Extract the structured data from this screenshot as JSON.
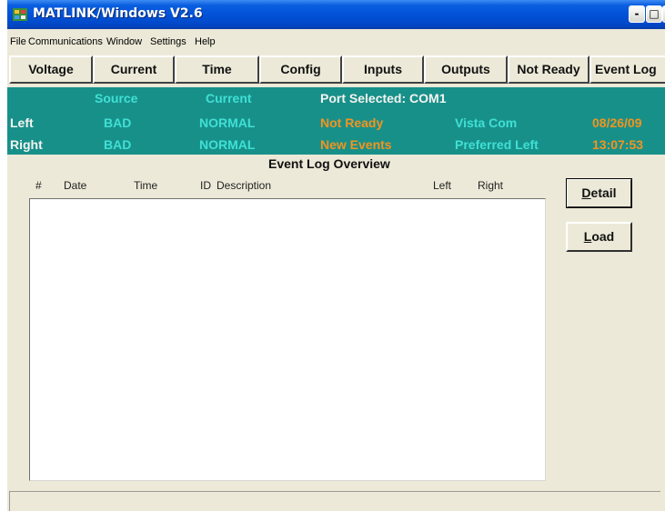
{
  "window": {
    "title": "MATLINK/Windows V2.6",
    "min_glyph": "-",
    "max_glyph": "□",
    "close_glyph": "x"
  },
  "menu": [
    "File",
    "Communications",
    "Window",
    "Settings",
    "Help"
  ],
  "toolbar": [
    "Voltage",
    "Current",
    "Time",
    "Config",
    "Inputs",
    "Outputs",
    "Not Ready",
    "Event Log"
  ],
  "status": {
    "header_source": "Source",
    "header_current": "Current",
    "port_selected": "Port Selected: COM1",
    "left_label": "Left",
    "left_source": "BAD",
    "left_current": "NORMAL",
    "left_state": "Not Ready",
    "left_info": "Vista Com",
    "date": "08/26/09",
    "right_label": "Right",
    "right_source": "BAD",
    "right_current": "NORMAL",
    "right_state": "New Events",
    "right_info": "Preferred Left",
    "time": "13:07:53",
    "colors": {
      "panel": "#18908a",
      "cyan_text": "#3fe0d4",
      "orange_text": "#f3941e",
      "white_text": "#f4f4f0"
    }
  },
  "event_log": {
    "title": "Event Log Overview",
    "columns": [
      "#",
      "Date",
      "Time",
      "ID",
      "Description",
      "Left",
      "Right"
    ],
    "rows": []
  },
  "buttons": {
    "detail_first": "D",
    "detail_rest": "etail",
    "load_first": "L",
    "load_rest": "oad"
  },
  "statusbar_text": ""
}
